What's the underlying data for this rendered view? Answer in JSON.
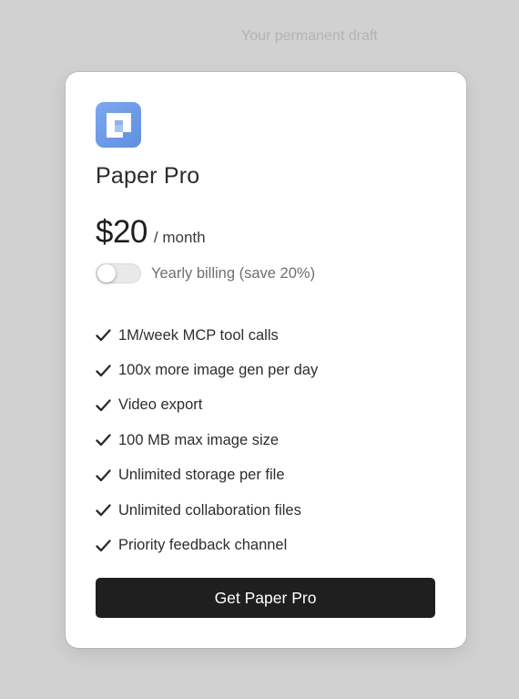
{
  "header": {
    "tagline": "Your permanent draft"
  },
  "card": {
    "logo_icon": "paper-logo-icon",
    "product_name": "Paper Pro",
    "price": "$20",
    "price_period": "/ month",
    "billing_toggle": {
      "label": "Yearly billing (save 20%)",
      "on": false
    },
    "features": [
      {
        "icon": "check-icon",
        "label": "1M/week MCP tool calls"
      },
      {
        "icon": "check-icon",
        "label": "100x more image gen per day"
      },
      {
        "icon": "check-icon",
        "label": "Video export"
      },
      {
        "icon": "check-icon",
        "label": "100 MB max image size"
      },
      {
        "icon": "check-icon",
        "label": "Unlimited storage per file"
      },
      {
        "icon": "check-icon",
        "label": "Unlimited collaboration files"
      },
      {
        "icon": "check-icon",
        "label": "Priority feedback channel"
      }
    ],
    "cta_label": "Get Paper Pro"
  },
  "colors": {
    "page_background": "#d1d1d1",
    "card_background": "#ffffff",
    "logo_blue": "#6f9be6",
    "cta_background": "#1f1f1f",
    "cta_text": "#ffffff"
  }
}
